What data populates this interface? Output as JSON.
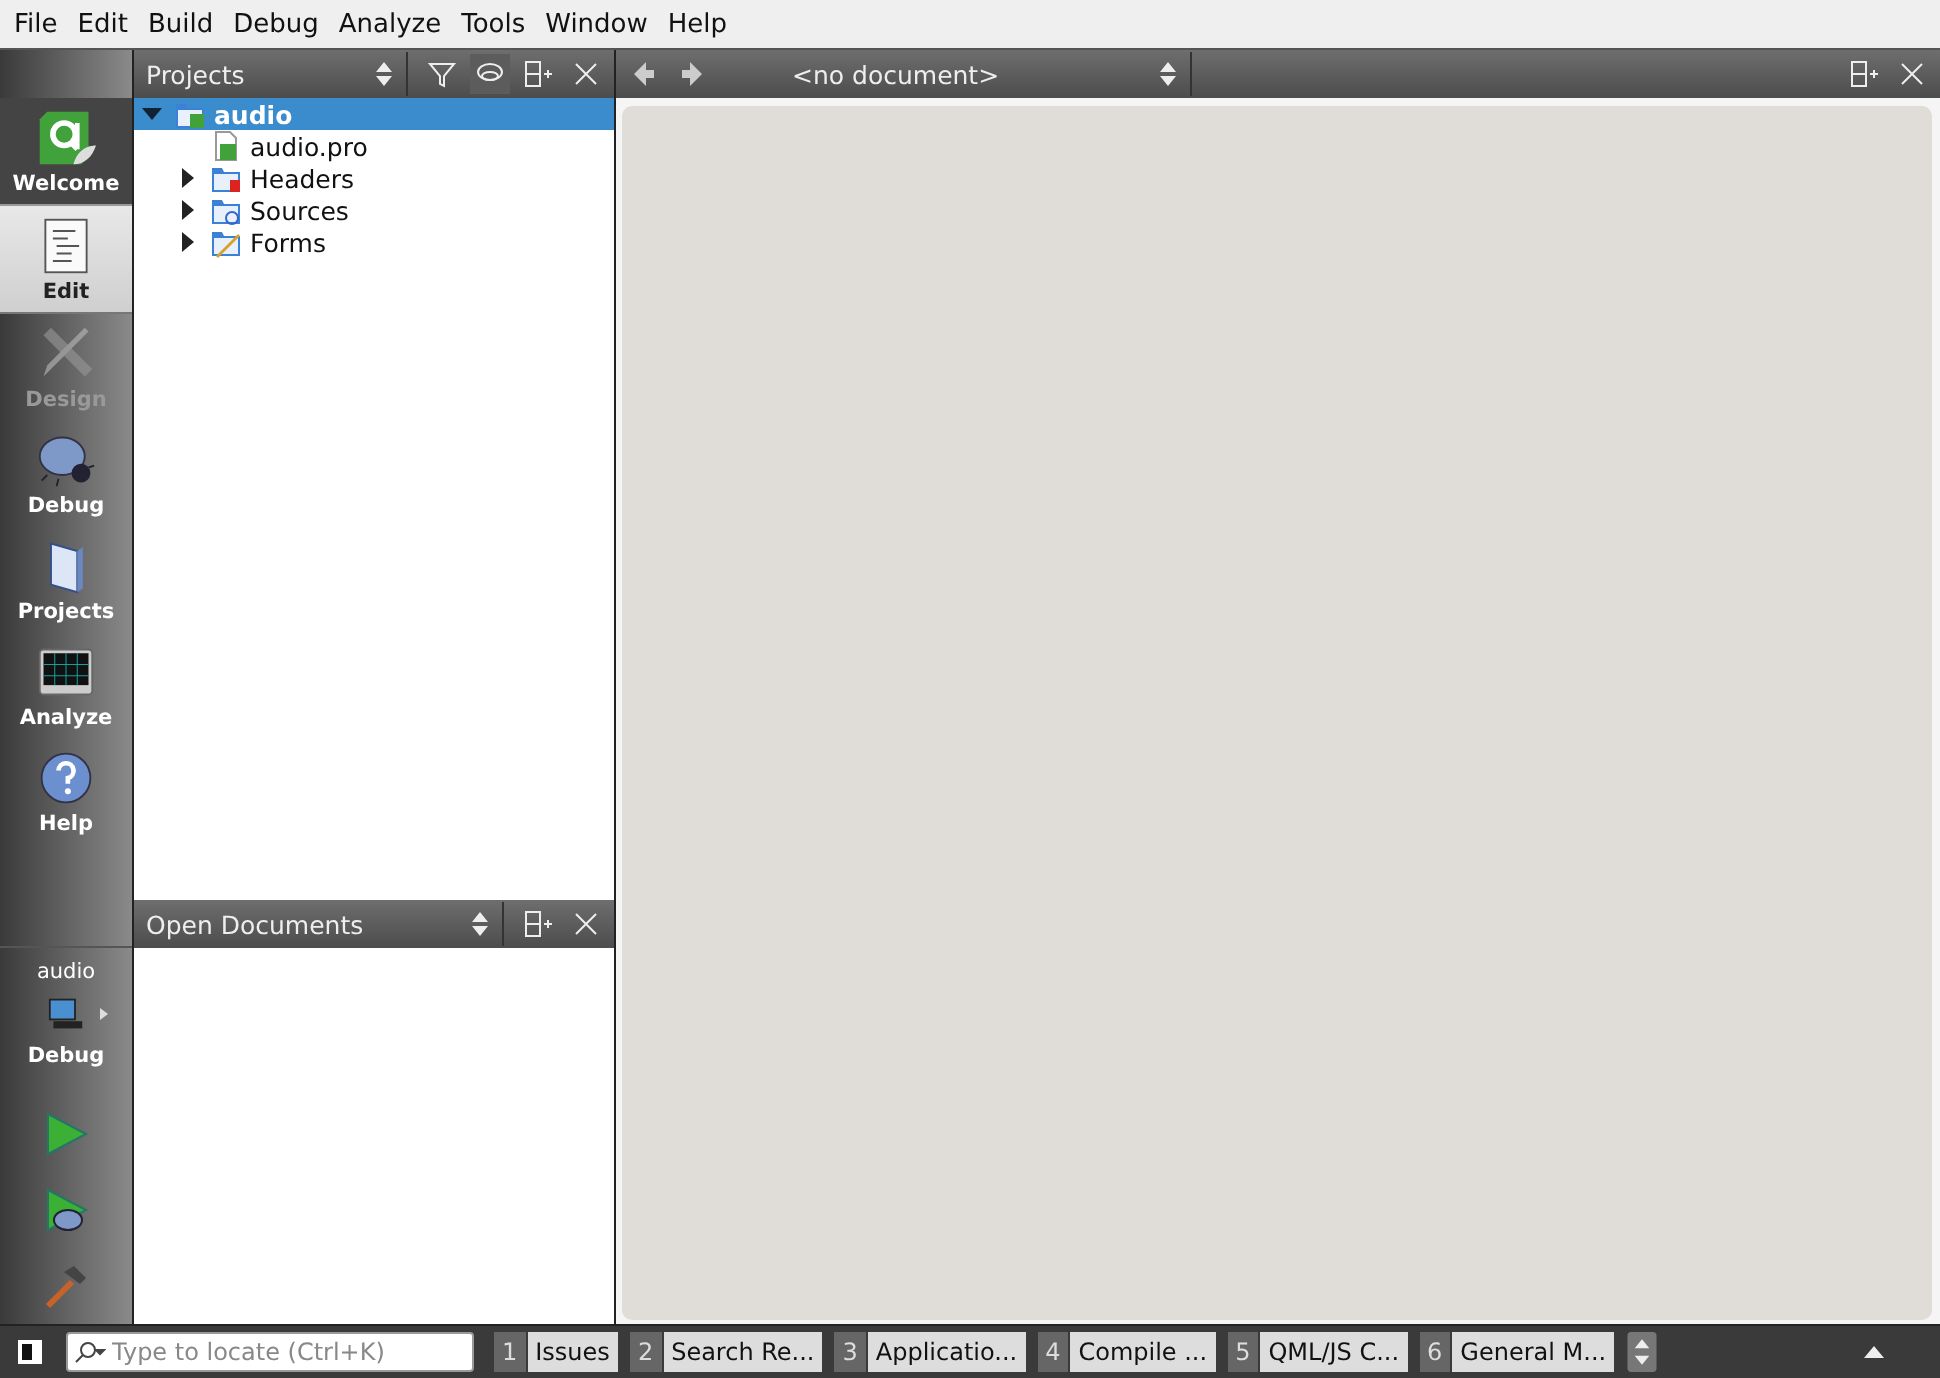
{
  "menu": [
    "File",
    "Edit",
    "Build",
    "Debug",
    "Analyze",
    "Tools",
    "Window",
    "Help"
  ],
  "modes": [
    {
      "label": "Welcome",
      "kind": "qt",
      "selected": false,
      "disabled": false
    },
    {
      "label": "Edit",
      "kind": "edit",
      "selected": true,
      "disabled": false
    },
    {
      "label": "Design",
      "kind": "design",
      "selected": false,
      "disabled": true
    },
    {
      "label": "Debug",
      "kind": "bug",
      "selected": false,
      "disabled": false
    },
    {
      "label": "Projects",
      "kind": "projects",
      "selected": false,
      "disabled": false
    },
    {
      "label": "Analyze",
      "kind": "analyze",
      "selected": false,
      "disabled": false
    },
    {
      "label": "Help",
      "kind": "help",
      "selected": false,
      "disabled": false
    }
  ],
  "target": {
    "project": "audio",
    "config": "Debug"
  },
  "projects_pane": {
    "title": "Projects",
    "tree": [
      {
        "label": "audio",
        "kind": "project",
        "expanded": true,
        "selected": true,
        "children": [
          {
            "label": "audio.pro",
            "kind": "pro",
            "selected": false
          },
          {
            "label": "Headers",
            "kind": "headers",
            "expanded": false,
            "selected": false
          },
          {
            "label": "Sources",
            "kind": "sources",
            "expanded": false,
            "selected": false
          },
          {
            "label": "Forms",
            "kind": "forms",
            "expanded": false,
            "selected": false
          }
        ]
      }
    ]
  },
  "open_documents": {
    "title": "Open Documents"
  },
  "editor": {
    "document": "<no document>"
  },
  "locator": {
    "placeholder": "Type to locate (Ctrl+K)"
  },
  "output_tabs": [
    {
      "number": "1",
      "label": "Issues"
    },
    {
      "number": "2",
      "label": "Search Re..."
    },
    {
      "number": "3",
      "label": "Applicatio..."
    },
    {
      "number": "4",
      "label": "Compile ..."
    },
    {
      "number": "5",
      "label": "QML/JS C..."
    },
    {
      "number": "6",
      "label": "General M..."
    }
  ]
}
